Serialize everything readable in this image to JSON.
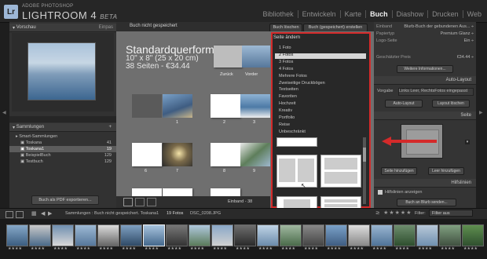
{
  "app": {
    "logo": "Lr",
    "vendor": "ADOBE PHOTOSHOP",
    "product": "LIGHTROOM 4",
    "edition": "BETA"
  },
  "modules": [
    "Bibliothek",
    "Entwickeln",
    "Karte",
    "Buch",
    "Diashow",
    "Drucken",
    "Web"
  ],
  "active_module": "Buch",
  "left_panel": {
    "preview_title": "Vorschau",
    "preview_zoom": "Einpas",
    "collections_title": "Sammlungen",
    "collections": [
      {
        "name": "Smart-Sammlungen",
        "count": ""
      },
      {
        "name": "Toskana",
        "count": "41"
      },
      {
        "name": "Toskana1",
        "count": "19"
      },
      {
        "name": "BeispielBuch",
        "count": "129"
      },
      {
        "name": "Testbuch",
        "count": "129"
      }
    ],
    "pdf_button": "Buch als PDF exportieren..."
  },
  "center": {
    "status": "Buch nicht gespeichert",
    "clear_button": "Buch löschen",
    "create_button": "Buch (gespeichert) erstellen",
    "title": "Standardquerformat",
    "size": "10\" x 8\" (25 x 20 cm)",
    "pages_price": "38 Seiten - €34.44",
    "back_label": "Zurück",
    "front_label": "Vorder",
    "page_numbers": [
      "1",
      "2",
      "3",
      "6",
      "7",
      "8",
      "9"
    ],
    "view_mode": "Einband - 38"
  },
  "dropdown": {
    "title": "Seite ändern",
    "items": [
      "1 Foto",
      "2 Fotos",
      "3 Fotos",
      "4 Fotos",
      "Mehrere Fotos",
      "Zweiseitige Druckbögen",
      "Textseiten",
      "Favoriten",
      "Hochzeit",
      "Kreativ",
      "Portfolio",
      "Reise",
      "Unbeschränkt"
    ],
    "selected": "2 Fotos"
  },
  "right_panel": {
    "rows": [
      {
        "label": "Einband",
        "value": "Blurb-Buch der gebundenen Aus..."
      },
      {
        "label": "Papiertyp",
        "value": "Premium Glanz"
      },
      {
        "label": "Logo-Seite",
        "value": "Ein"
      },
      {
        "label": "Geschätzter Preis",
        "value": "€34.44"
      }
    ],
    "prefs_button": "Weitere Informationen...",
    "autolayout_title": "Auto-Layout",
    "preset_label": "Vorgabe",
    "preset_value": "Links Leer, RechtsFotos eingepasst",
    "autolayout_button": "Auto-Layout",
    "clear_layout_button": "Layout löschen",
    "page_title": "Seite",
    "add_page_button": "Seite hinzufügen",
    "add_blank_button": "Leer hinzufügen",
    "guides_title": "Hilfslinien",
    "guides_checkbox": "Hilfslinien anzeigen",
    "send_button": "Buch an Blurb senden..."
  },
  "toolbar": {
    "collection_path": "Sammlungen : Buch nicht gespeichert. Toskana1",
    "photo_count": "19 Fotos",
    "filename": "DSC_0208.JPG",
    "filter_label": "Filter:",
    "filter_value": "Filter aus"
  },
  "colors": {
    "highlight": "#d42a2a",
    "accent": "#9db7d6"
  }
}
